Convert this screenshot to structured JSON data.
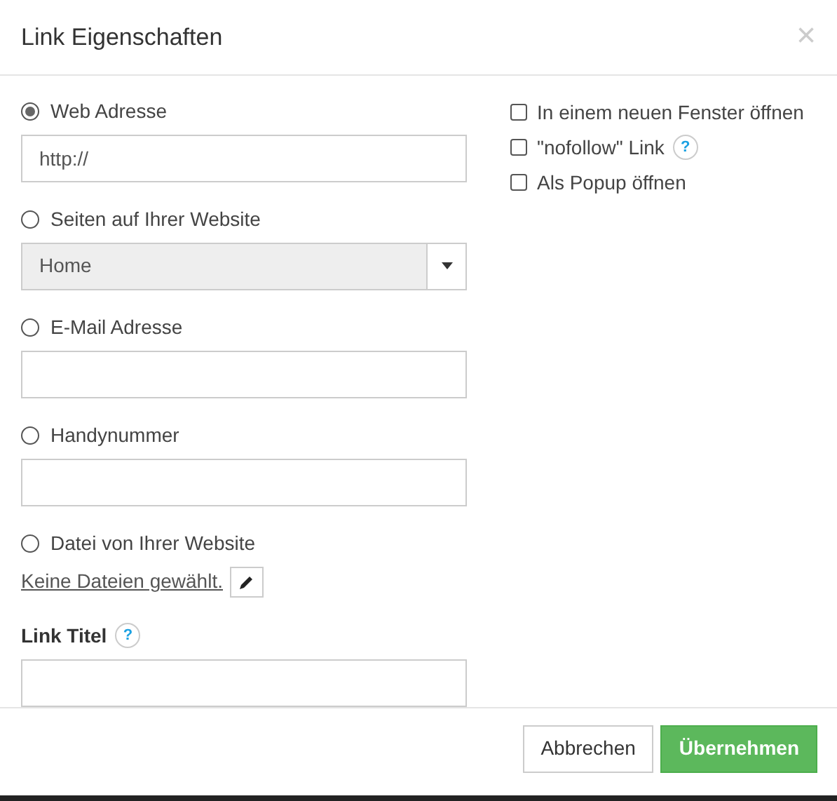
{
  "dialog": {
    "title": "Link Eigenschaften",
    "close": "×"
  },
  "link_types": [
    {
      "label": "Web Adresse",
      "selected": true,
      "kind": "text",
      "value": "http://"
    },
    {
      "label": "Seiten auf Ihrer Website",
      "selected": false,
      "kind": "select",
      "value": "Home"
    },
    {
      "label": "E-Mail Adresse",
      "selected": false,
      "kind": "text"
    },
    {
      "label": "Handynummer",
      "selected": false,
      "kind": "text"
    },
    {
      "label": "Datei von Ihrer Website",
      "selected": false,
      "kind": "file",
      "value": "Keine Dateien gewählt."
    }
  ],
  "title_field": {
    "label": "Link Titel",
    "help": "?"
  },
  "options": [
    {
      "label": "In einem neuen Fenster öffnen",
      "checked": false
    },
    {
      "label": "\"nofollow\" Link",
      "checked": false,
      "help": "?"
    },
    {
      "label": "Als Popup öffnen",
      "checked": false
    }
  ],
  "buttons": {
    "cancel": "Abbrechen",
    "apply": "Übernehmen"
  }
}
